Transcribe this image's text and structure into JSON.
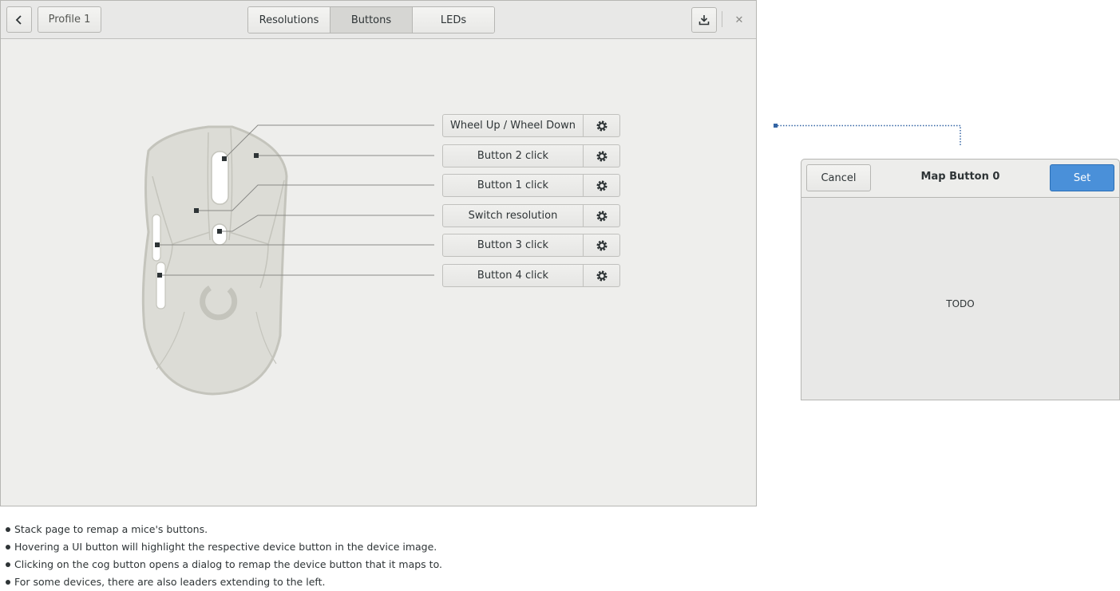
{
  "header": {
    "back_icon": "chevron-left-icon",
    "profile_label": "Profile 1",
    "tabs": [
      {
        "label": "Resolutions",
        "active": false
      },
      {
        "label": "Buttons",
        "active": true
      },
      {
        "label": "LEDs",
        "active": false
      }
    ],
    "save_icon": "save-download-icon",
    "close_icon": "close-icon"
  },
  "mappings": [
    {
      "label": "Wheel Up / Wheel Down",
      "icon": "gear-icon"
    },
    {
      "label": "Button 2 click",
      "icon": "gear-icon"
    },
    {
      "label": "Button 1 click",
      "icon": "gear-icon"
    },
    {
      "label": "Switch resolution",
      "icon": "gear-icon"
    },
    {
      "label": "Button 3 click",
      "icon": "gear-icon"
    },
    {
      "label": "Button 4 click",
      "icon": "gear-icon"
    }
  ],
  "dialog": {
    "cancel_label": "Cancel",
    "title": "Map Button 0",
    "set_label": "Set",
    "body_text": "TODO"
  },
  "notes": [
    "Stack page to remap a mice's buttons.",
    "Hovering a UI button will highlight the respective device button in the device image.",
    "Clicking on the cog button opens a dialog to remap the device button that it maps to.",
    "For some devices, there are also leaders extending to the left."
  ],
  "colors": {
    "accent": "#4a90d9",
    "window_bg": "#eeeeec",
    "mouse_body": "#dcdcd6",
    "leader_line": "#8a8a87"
  }
}
